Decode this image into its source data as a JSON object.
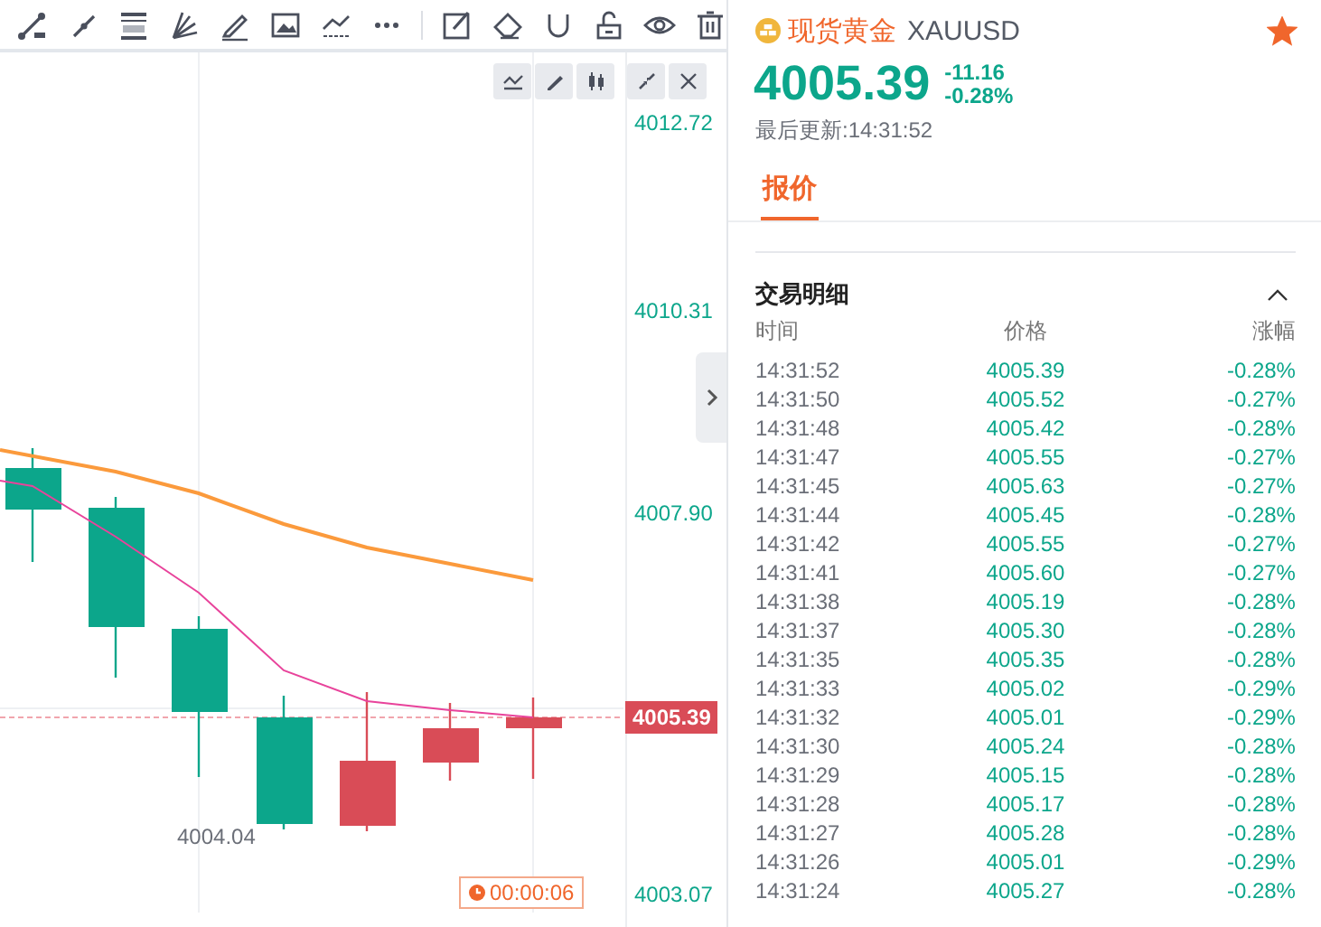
{
  "chart": {
    "price_labels": [
      "4012.72",
      "4010.31",
      "4007.90",
      "4003.07"
    ],
    "current_price": "4005.39",
    "low_label": "4004.04",
    "timer": "00:00:06"
  },
  "quote": {
    "name": "现货黄金",
    "symbol": "XAUUSD",
    "favorite": true,
    "price": "4005.39",
    "change": "-11.16",
    "change_pct": "-0.28%",
    "updated": "最后更新:14:31:52"
  },
  "tabs": [
    {
      "label": "报价",
      "selected": true
    }
  ],
  "trades": {
    "title": "交易明细",
    "expanded": true,
    "columns": [
      "时间",
      "价格",
      "涨幅"
    ],
    "rows": [
      {
        "time": "14:31:52",
        "price": "4005.39",
        "change": "-0.28%"
      },
      {
        "time": "14:31:50",
        "price": "4005.52",
        "change": "-0.27%"
      },
      {
        "time": "14:31:48",
        "price": "4005.42",
        "change": "-0.28%"
      },
      {
        "time": "14:31:47",
        "price": "4005.55",
        "change": "-0.27%"
      },
      {
        "time": "14:31:45",
        "price": "4005.63",
        "change": "-0.27%"
      },
      {
        "time": "14:31:44",
        "price": "4005.45",
        "change": "-0.28%"
      },
      {
        "time": "14:31:42",
        "price": "4005.55",
        "change": "-0.27%"
      },
      {
        "time": "14:31:41",
        "price": "4005.60",
        "change": "-0.27%"
      },
      {
        "time": "14:31:38",
        "price": "4005.19",
        "change": "-0.28%"
      },
      {
        "time": "14:31:37",
        "price": "4005.30",
        "change": "-0.28%"
      },
      {
        "time": "14:31:35",
        "price": "4005.35",
        "change": "-0.28%"
      },
      {
        "time": "14:31:33",
        "price": "4005.02",
        "change": "-0.29%"
      },
      {
        "time": "14:31:32",
        "price": "4005.01",
        "change": "-0.29%"
      },
      {
        "time": "14:31:30",
        "price": "4005.24",
        "change": "-0.28%"
      },
      {
        "time": "14:31:29",
        "price": "4005.15",
        "change": "-0.28%"
      },
      {
        "time": "14:31:28",
        "price": "4005.17",
        "change": "-0.28%"
      },
      {
        "time": "14:31:27",
        "price": "4005.28",
        "change": "-0.28%"
      },
      {
        "time": "14:31:26",
        "price": "4005.01",
        "change": "-0.29%"
      },
      {
        "time": "14:31:24",
        "price": "4005.27",
        "change": "-0.28%"
      }
    ]
  }
}
